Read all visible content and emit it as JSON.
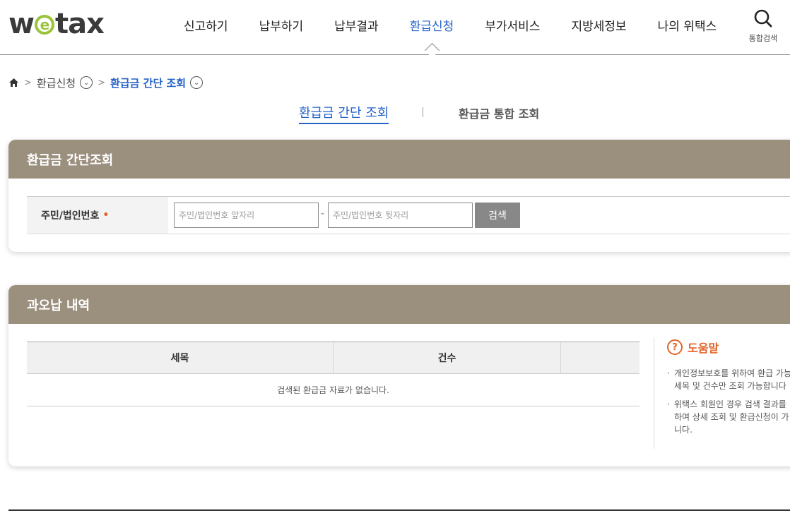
{
  "header": {
    "logo_text_1": "w",
    "logo_text_e": "e",
    "logo_text_2": "tax",
    "nav": [
      {
        "label": "신고하기"
      },
      {
        "label": "납부하기"
      },
      {
        "label": "납부결과"
      },
      {
        "label": "환급신청",
        "active": true
      },
      {
        "label": "부가서비스"
      },
      {
        "label": "지방세정보"
      },
      {
        "label": "나의 위택스"
      }
    ],
    "search_label": "통합검색",
    "search_icon": "search-icon"
  },
  "breadcrumb": {
    "home_icon": "home-icon",
    "level1": "환급신청",
    "level2": "환급금 간단 조회"
  },
  "subtabs": {
    "tab1": "환급금 간단 조회",
    "tab2": "환급금 통합 조회"
  },
  "panel1": {
    "title": "환급금 간단조회",
    "field_label": "주민/법인번호",
    "required_mark": "•",
    "front_placeholder": "주민/법인번호 앞자리",
    "back_placeholder": "주민/법인번호 뒷자리",
    "dash": "-",
    "search_button": "검색"
  },
  "panel2": {
    "title": "과오납 내역",
    "columns": [
      "세목",
      "건수"
    ],
    "empty_message": "검색된 환급금 자료가 없습니다.",
    "help": {
      "title": "도움말",
      "items": [
        "개인정보보호를 위하여 환급 가능\n세목 및 건수만 조회 가능합니다",
        "위택스 회원인 경우 검색 결과를\n하여 상세 조회 및 환급신청이 가\n니다."
      ]
    }
  },
  "colors": {
    "accent_blue": "#2563c8",
    "panel_header": "#9b8f7e",
    "orange": "#e3642a",
    "logo_green": "#9ac43a"
  }
}
